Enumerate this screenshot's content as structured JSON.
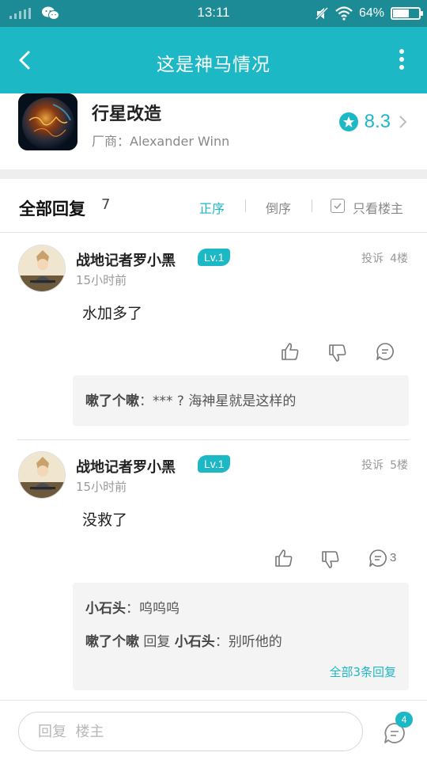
{
  "status_bar": {
    "time": "13:11",
    "battery": "64%",
    "battery_level": 0.64,
    "icons": [
      "signal-icon",
      "wechat-icon",
      "mute-icon",
      "wifi-icon",
      "battery-icon"
    ]
  },
  "app_bar": {
    "title": "这是神马情况",
    "back_icon": "back-arrow-icon",
    "menu_icon": "more-vertical-icon"
  },
  "game": {
    "name": "行星改造",
    "developer": "厂商：Alexander Winn",
    "rating": "8.3"
  },
  "replies_header": {
    "title": "全部回复",
    "count": "7",
    "sort_asc": "正序",
    "sort_desc": "倒序",
    "owner_only": "只看楼主",
    "active_color": "#1db8c5"
  },
  "posts": [
    {
      "username": "战地记者罗小黑",
      "level": "Lv.1",
      "time": "15小时前",
      "report": "投诉",
      "floor": "4楼",
      "body": "水加多了",
      "comment_count": "",
      "subreplies": [
        {
          "author": "嗽了个嗽",
          "sep": "：",
          "text": "*** ? 海神星就是这样的"
        }
      ]
    },
    {
      "username": "战地记者罗小黑",
      "level": "Lv.1",
      "time": "15小时前",
      "report": "投诉",
      "floor": "5楼",
      "body": "没救了",
      "comment_count": "3",
      "subreplies": [
        {
          "author": "小石头",
          "sep": "：",
          "text": "呜呜呜"
        },
        {
          "author": "嗽了个嗽",
          "mid": "回复",
          "target": "小石头",
          "sep": "：",
          "text": "别听他的"
        }
      ],
      "more_link": "全部3条回复"
    }
  ],
  "bottom_bar": {
    "placeholder": "回复  楼主",
    "badge_count": "4"
  },
  "colors": {
    "status_bar": "#1c8b96",
    "app_bar": "#1db8c5",
    "accent": "#1db8c5"
  }
}
